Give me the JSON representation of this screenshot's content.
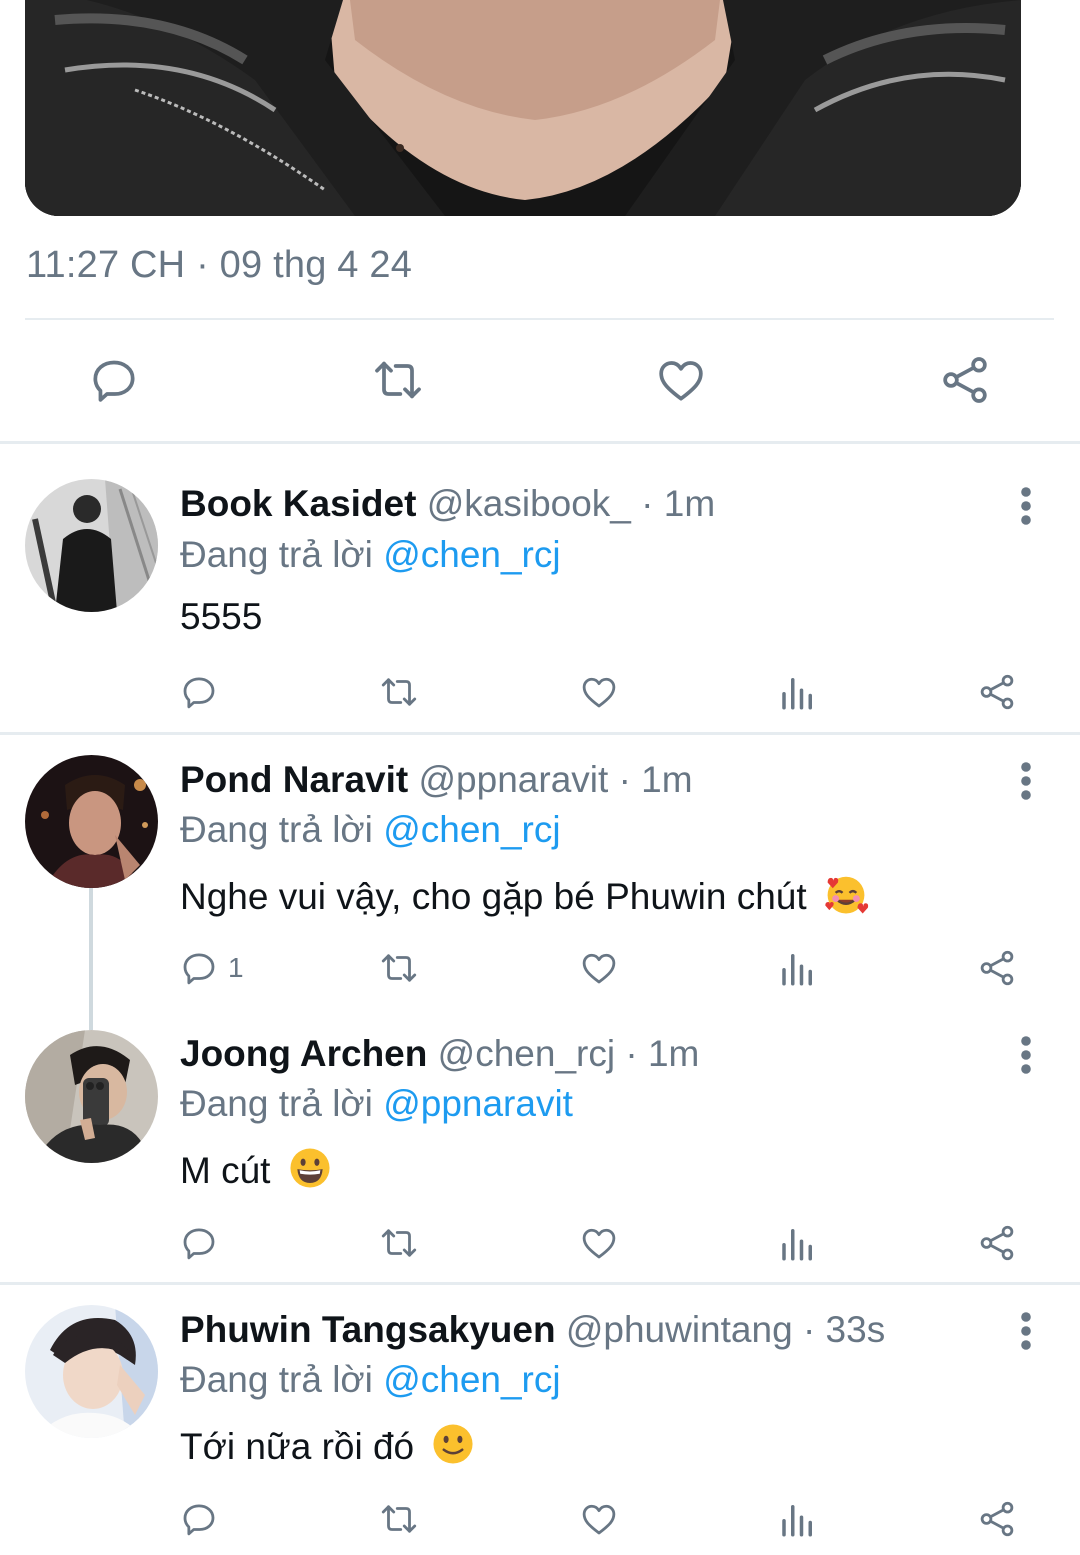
{
  "tweet": {
    "timestamp": "11:27 CH · 09 thg 4 24",
    "media_alt": "photo"
  },
  "main_actions": [
    "reply-icon",
    "retweet-icon",
    "like-icon",
    "share-icon"
  ],
  "replies": [
    {
      "name": "Book Kasidet",
      "handle": "@kasibook_",
      "time": "· 1m",
      "replying_prefix": "Đang trả lời",
      "replying_to": "@chen_rcj",
      "text": "5555",
      "emoji": "",
      "reply_count": ""
    },
    {
      "name": "Pond Naravit",
      "handle": "@ppnaravit",
      "time": "· 1m",
      "replying_prefix": "Đang trả lời",
      "replying_to": "@chen_rcj",
      "text": "Nghe vui vậy, cho gặp bé Phuwin chút",
      "emoji": "smiling-face-with-hearts",
      "reply_count": "1"
    },
    {
      "name": "Joong Archen",
      "handle": "@chen_rcj",
      "time": "· 1m",
      "replying_prefix": "Đang trả lời",
      "replying_to": "@ppnaravit",
      "text": "M cút",
      "emoji": "grinning-face",
      "reply_count": ""
    },
    {
      "name": "Phuwin Tangsakyuen",
      "handle": "@phuwintang",
      "time": "· 33s",
      "replying_prefix": "Đang trả lời",
      "replying_to": "@chen_rcj",
      "text": "Tới nữa rồi đó",
      "emoji": "slightly-smiling-face",
      "reply_count": ""
    }
  ],
  "colors": {
    "link": "#1d9bf0",
    "muted": "#687684",
    "text": "#0f1419",
    "divider": "#e6ecf0"
  }
}
